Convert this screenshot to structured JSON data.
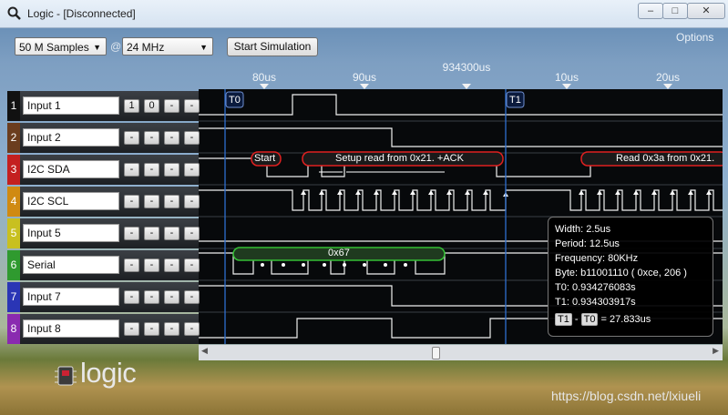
{
  "window": {
    "title": "Logic - [Disconnected]",
    "minimize": "–",
    "maximize": "□",
    "close": "✕",
    "app_icon": "magnifier-icon"
  },
  "toolbar": {
    "samples_value": "50 M Samples",
    "at": "@",
    "rate_value": "24 MHz",
    "start_button": "Start Simulation",
    "options": "Options"
  },
  "timeline": {
    "labels": [
      "80us",
      "90us",
      "934300us",
      "10us",
      "20us"
    ]
  },
  "channels": [
    {
      "num": "1",
      "name": "Input 1",
      "color": "#111111",
      "triggers": [
        "1",
        "0",
        "-",
        "-"
      ]
    },
    {
      "num": "2",
      "name": "Input 2",
      "color": "#6b3d1e",
      "triggers": [
        "-",
        "-",
        "-",
        "-"
      ]
    },
    {
      "num": "3",
      "name": "I2C SDA",
      "color": "#c42020",
      "triggers": [
        "-",
        "-",
        "-",
        "-"
      ]
    },
    {
      "num": "4",
      "name": "I2C SCL",
      "color": "#d08a12",
      "triggers": [
        "-",
        "-",
        "-",
        "-"
      ]
    },
    {
      "num": "5",
      "name": "Input 5",
      "color": "#c8c020",
      "triggers": [
        "-",
        "-",
        "-",
        "-"
      ]
    },
    {
      "num": "6",
      "name": "Serial",
      "color": "#2f9a2f",
      "triggers": [
        "-",
        "-",
        "-",
        "-"
      ]
    },
    {
      "num": "7",
      "name": "Input 7",
      "color": "#2a35b5",
      "triggers": [
        "-",
        "-",
        "-",
        "-"
      ]
    },
    {
      "num": "8",
      "name": "Input 8",
      "color": "#8a2ab0",
      "triggers": [
        "-",
        "-",
        "-",
        "-"
      ]
    }
  ],
  "markers": {
    "t0": "T0",
    "t1": "T1"
  },
  "annotations": {
    "start": "Start",
    "setup": "Setup read from 0x21. +ACK",
    "read": "Read 0x3a from 0x21.",
    "serial_byte": "0x67"
  },
  "measurement": {
    "width": "Width: 2.5us",
    "period": "Period: 12.5us",
    "frequency": "Frequency: 80KHz",
    "byte": "Byte: b11001110 ( 0xce, 206 )",
    "t0": "T0: 0.934276083s",
    "t1": "T1: 0.934303917s",
    "delta_t1": "T1",
    "delta_minus": "-",
    "delta_t0": "T0",
    "delta_value": "= 27.833us"
  },
  "logo_text": "logic",
  "watermark": "https://blog.csdn.net/lxiueli"
}
